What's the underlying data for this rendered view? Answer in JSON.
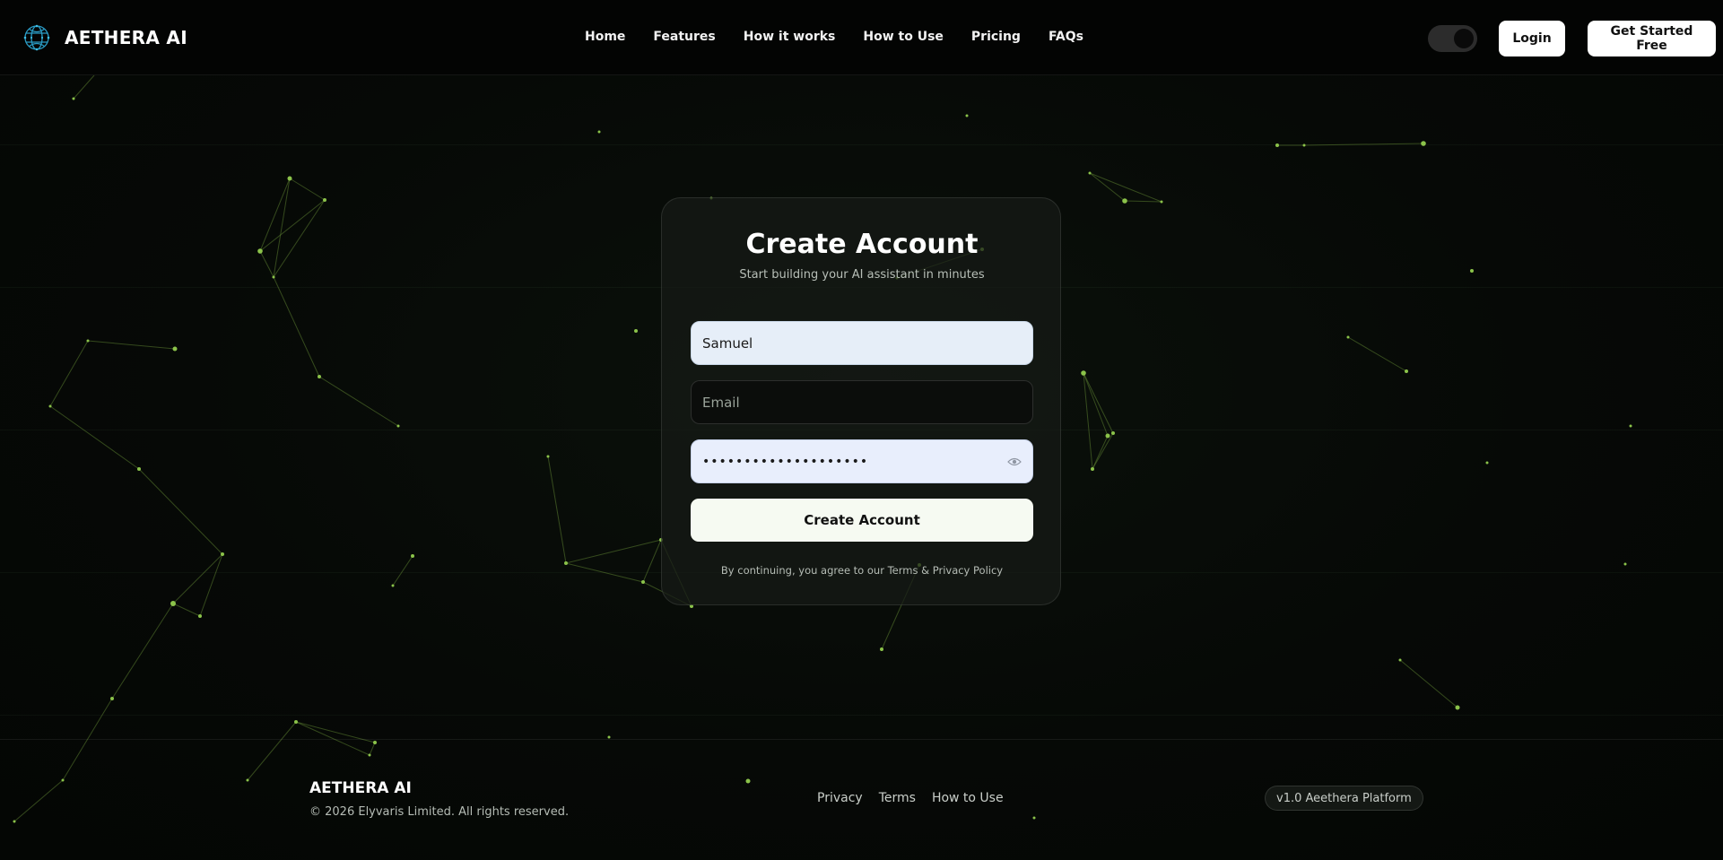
{
  "brand": {
    "name": "AETHERA AI",
    "logo_icon": "neural-globe-icon"
  },
  "nav": {
    "items": [
      "Home",
      "Features",
      "How it works",
      "How to Use",
      "Pricing",
      "FAQs"
    ]
  },
  "header": {
    "theme_toggle": "dark",
    "login_label": "Login",
    "get_started_label": "Get Started Free"
  },
  "card": {
    "title": "Create Account",
    "subtitle": "Start building your AI assistant in minutes",
    "name_value": "Samuel",
    "email_placeholder": "Email",
    "password_value": "••••••••••••••••••••",
    "submit_label": "Create Account",
    "terms_text": "By continuing, you agree to our Terms & Privacy Policy"
  },
  "footer": {
    "brand": "AETHERA AI",
    "copyright": "© 2026 Elyvaris Limited. All rights reserved.",
    "links": [
      "Privacy",
      "Terms",
      "How to Use"
    ],
    "version": "v1.0 Aeethera Platform"
  },
  "colors": {
    "background": "#050805",
    "accent_particles": "#8bc34a",
    "button_bg": "#ffffff"
  }
}
